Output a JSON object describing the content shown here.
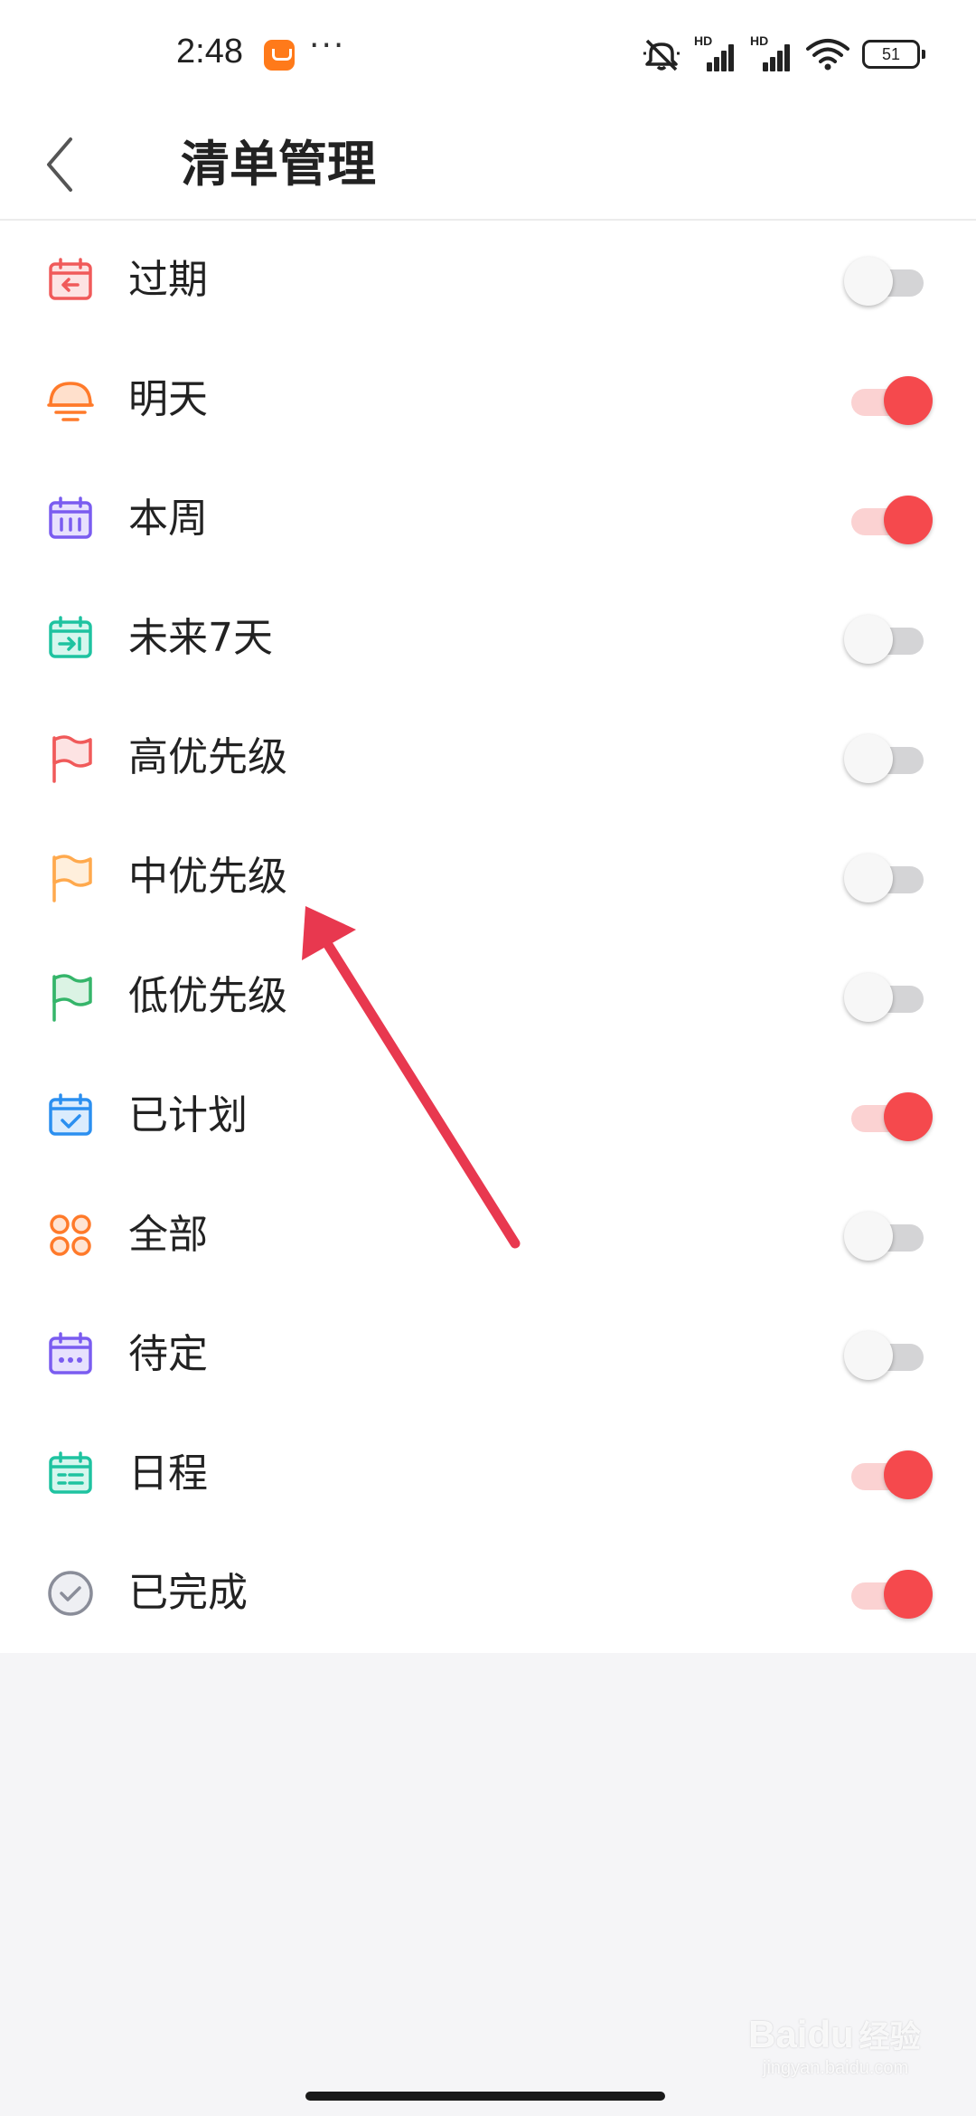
{
  "status_bar": {
    "time": "2:48",
    "more": "···",
    "battery": "51",
    "signal_1_label": "HD",
    "signal_2_label": "HD"
  },
  "header": {
    "title": "清单管理"
  },
  "list": [
    {
      "label": "过期",
      "icon": "calendar-back-icon",
      "enabled": false,
      "color": "#f05a5a"
    },
    {
      "label": "明天",
      "icon": "sunrise-icon",
      "enabled": true,
      "color": "#ff7a2a"
    },
    {
      "label": "本周",
      "icon": "calendar-week-icon",
      "enabled": true,
      "color": "#7a5cf0"
    },
    {
      "label": "未来7天",
      "icon": "calendar-forward-icon",
      "enabled": false,
      "color": "#1ec3a0"
    },
    {
      "label": "高优先级",
      "icon": "flag-high-icon",
      "enabled": false,
      "color": "#f05a5a"
    },
    {
      "label": "中优先级",
      "icon": "flag-medium-icon",
      "enabled": false,
      "color": "#ffa94d"
    },
    {
      "label": "低优先级",
      "icon": "flag-low-icon",
      "enabled": false,
      "color": "#35b56a"
    },
    {
      "label": "已计划",
      "icon": "calendar-check-icon",
      "enabled": true,
      "color": "#2b8ff0"
    },
    {
      "label": "全部",
      "icon": "four-circles-icon",
      "enabled": false,
      "color": "#ff7a2a"
    },
    {
      "label": "待定",
      "icon": "calendar-dots-icon",
      "enabled": false,
      "color": "#7a5cf0"
    },
    {
      "label": "日程",
      "icon": "calendar-list-icon",
      "enabled": true,
      "color": "#1ec3a0"
    },
    {
      "label": "已完成",
      "icon": "check-circle-icon",
      "enabled": true,
      "color": "#8a8d99"
    }
  ],
  "annotation": {
    "arrow_color": "#e8384f"
  },
  "watermark": {
    "brand": "Baidu",
    "brand_cn": "经验",
    "url": "jingyan.baidu.com"
  }
}
